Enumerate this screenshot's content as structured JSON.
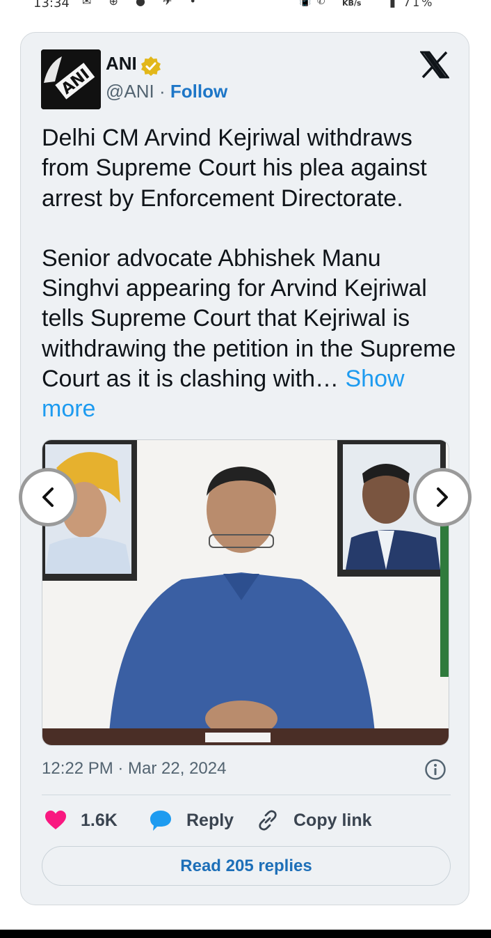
{
  "status_bar": {
    "time": "13:34",
    "network_speed_label": "KB/s",
    "battery": "71%"
  },
  "tweet": {
    "author": {
      "name": "ANI",
      "handle": "@ANI",
      "separator": "·",
      "follow_label": "Follow",
      "verified": true,
      "avatar_logo_text": "ANI"
    },
    "paragraphs": [
      "Delhi CM Arvind Kejriwal withdraws from Supreme Court his plea against arrest by Enforcement Directorate.",
      "Senior advocate Abhishek Manu Singhvi appearing for Arvind Kejriwal tells Supreme Court that Kejriwal is withdrawing the petition in the Supreme Court as it is clashing with…"
    ],
    "show_more_label": "Show more",
    "timestamp": "12:22 PM · Mar 22, 2024",
    "actions": {
      "like_count": "1.6K",
      "reply_label": "Reply",
      "copy_link_label": "Copy link"
    },
    "read_replies_label": "Read 205 replies"
  },
  "colors": {
    "card_bg": "#eef1f4",
    "link_blue": "#1d9bf0",
    "follow_blue": "#1d76c7",
    "like_pink": "#f91880",
    "reply_blue": "#1d9bf0"
  },
  "icons": [
    "verified-badge-icon",
    "x-logo-icon",
    "chevron-left-icon",
    "chevron-right-icon",
    "info-icon",
    "heart-icon",
    "reply-bubble-icon",
    "link-icon"
  ]
}
